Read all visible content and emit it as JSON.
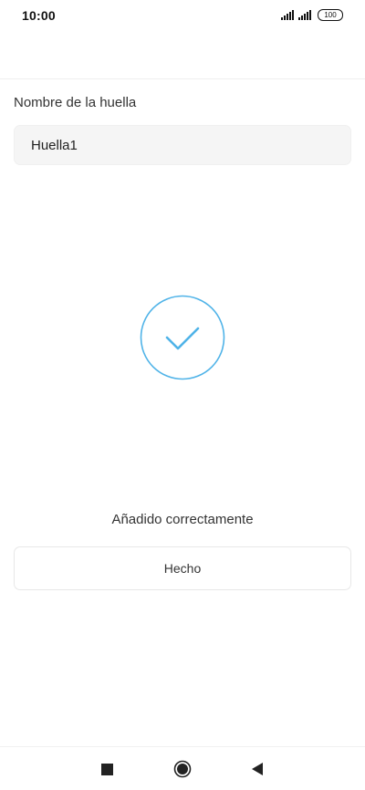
{
  "status_bar": {
    "time": "10:00",
    "battery": "100"
  },
  "form": {
    "name_label": "Nombre de la huella",
    "name_value": "Huella1"
  },
  "result": {
    "icon": "checkmark-circle-icon",
    "accent_color": "#4fb3e8",
    "message": "Añadido correctamente"
  },
  "actions": {
    "done_label": "Hecho"
  },
  "nav": {
    "recents_icon": "square-icon",
    "home_icon": "circle-icon",
    "back_icon": "triangle-back-icon"
  }
}
